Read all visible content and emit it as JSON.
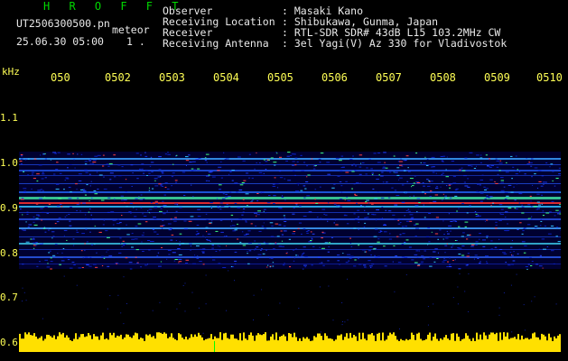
{
  "header": {
    "app_name": "H R O F F T",
    "filename": "UT2506300500.pn",
    "mode": "meteor",
    "datetime": "25.06.30 05:00",
    "index": "1 ."
  },
  "info": {
    "labels": [
      "Observer",
      "Receiving Location",
      "Receiver",
      "Receiving Antenna"
    ],
    "values": [
      ": Masaki Kano",
      ": Shibukawa, Gunma, Japan",
      ": RTL-SDR SDR# 43dB L15 103.2MHz CW",
      ": 3el Yagi(V) Az 330 for Vladivostok"
    ]
  },
  "axis": {
    "unit": "kHz",
    "x_ticks": [
      "050",
      "0502",
      "0503",
      "0504",
      "0505",
      "0506",
      "0507",
      "0508",
      "0509",
      "0510"
    ],
    "y_ticks": [
      "1.1",
      "1.0",
      "0.9",
      "0.8",
      "0.7",
      "0.6"
    ]
  },
  "colors": {
    "text_green": "#00d800",
    "text_yellow": "#ffff55",
    "text_white": "#e8e8e8",
    "signal_low": "#0000a0",
    "signal_high": "#ff2020"
  }
}
